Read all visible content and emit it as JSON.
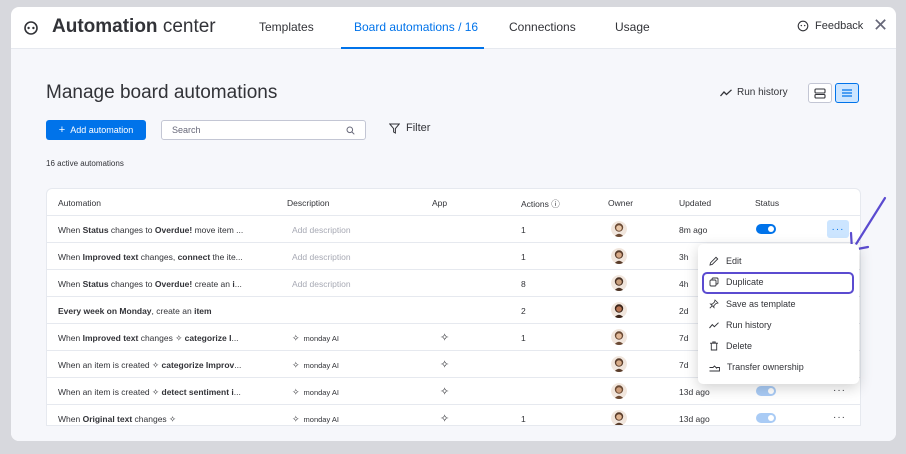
{
  "header": {
    "title_bold": "Automation",
    "title_rest": "center",
    "tabs": [
      {
        "label": "Templates"
      },
      {
        "label": "Board automations / 16"
      },
      {
        "label": "Connections"
      },
      {
        "label": "Usage"
      }
    ],
    "feedback_label": "Feedback",
    "close_symbol": "✕"
  },
  "page": {
    "title": "Manage board automations",
    "run_history_label": "Run history",
    "add_button_label": "Add automation",
    "search_placeholder": "Search",
    "filter_label": "Filter",
    "count_text": "16 active automations"
  },
  "table": {
    "columns": [
      "Automation",
      "Description",
      "App",
      "Actions ⓘ",
      "Owner",
      "Updated",
      "Status"
    ],
    "rows": [
      {
        "automation_html": "When <b>Status</b> changes to <b>Overdue!</b> move item ...",
        "description": "Add description",
        "app": "",
        "actions": "1",
        "updated": "8m ago",
        "status_on": true
      },
      {
        "automation_html": "When <b>Improved text</b> changes, <b>connect</b> the ite...",
        "description": "Add description",
        "app": "",
        "actions": "1",
        "updated": "3h",
        "status_on": true
      },
      {
        "automation_html": "When <b>Status</b> changes to <b>Overdue!</b> create an <b>i</b>...",
        "description": "Add description",
        "app": "",
        "actions": "8",
        "updated": "4h",
        "status_on": true
      },
      {
        "automation_html": "<b>Every week on Monday</b>, create an <b>item</b>",
        "description": "",
        "app": "",
        "actions": "2",
        "updated": "2d",
        "status_on": true
      },
      {
        "automation_html": "When <b>Improved text</b> changes ✧ <b>categorize I</b>...",
        "description": "monday AI",
        "app": "ai",
        "actions": "1",
        "updated": "7d",
        "status_on": true
      },
      {
        "automation_html": "When an item is created ✧ <b>categorize Improv</b>...",
        "description": "monday AI",
        "app": "ai",
        "actions": "",
        "updated": "7d",
        "status_on": true
      },
      {
        "automation_html": "When an item is created ✧ <b>detect sentiment i</b>...",
        "description": "monday AI",
        "app": "ai",
        "actions": "",
        "updated": "13d ago",
        "status_on": true
      },
      {
        "automation_html": "When <b>Original text</b> changes ✧",
        "description": "monday AI",
        "app": "ai",
        "actions": "1",
        "updated": "13d ago",
        "status_on": true
      }
    ]
  },
  "menu": {
    "items": [
      {
        "label": "Edit"
      },
      {
        "label": "Duplicate"
      },
      {
        "label": "Save as template"
      },
      {
        "label": "Run history"
      },
      {
        "label": "Delete"
      },
      {
        "label": "Transfer ownership"
      }
    ]
  },
  "colors": {
    "accent": "#0073ea",
    "highlight_outline": "#5b4bd0"
  },
  "icons": [
    "monday-logo-icon",
    "feedback-icon",
    "close-icon",
    "run-history-icon",
    "list-view-icon",
    "table-view-icon",
    "plus-icon",
    "search-icon",
    "filter-icon",
    "ai-sparkle-icon",
    "edit-icon",
    "duplicate-icon",
    "save-template-icon",
    "delete-icon",
    "transfer-icon",
    "annotation-arrow-icon"
  ]
}
